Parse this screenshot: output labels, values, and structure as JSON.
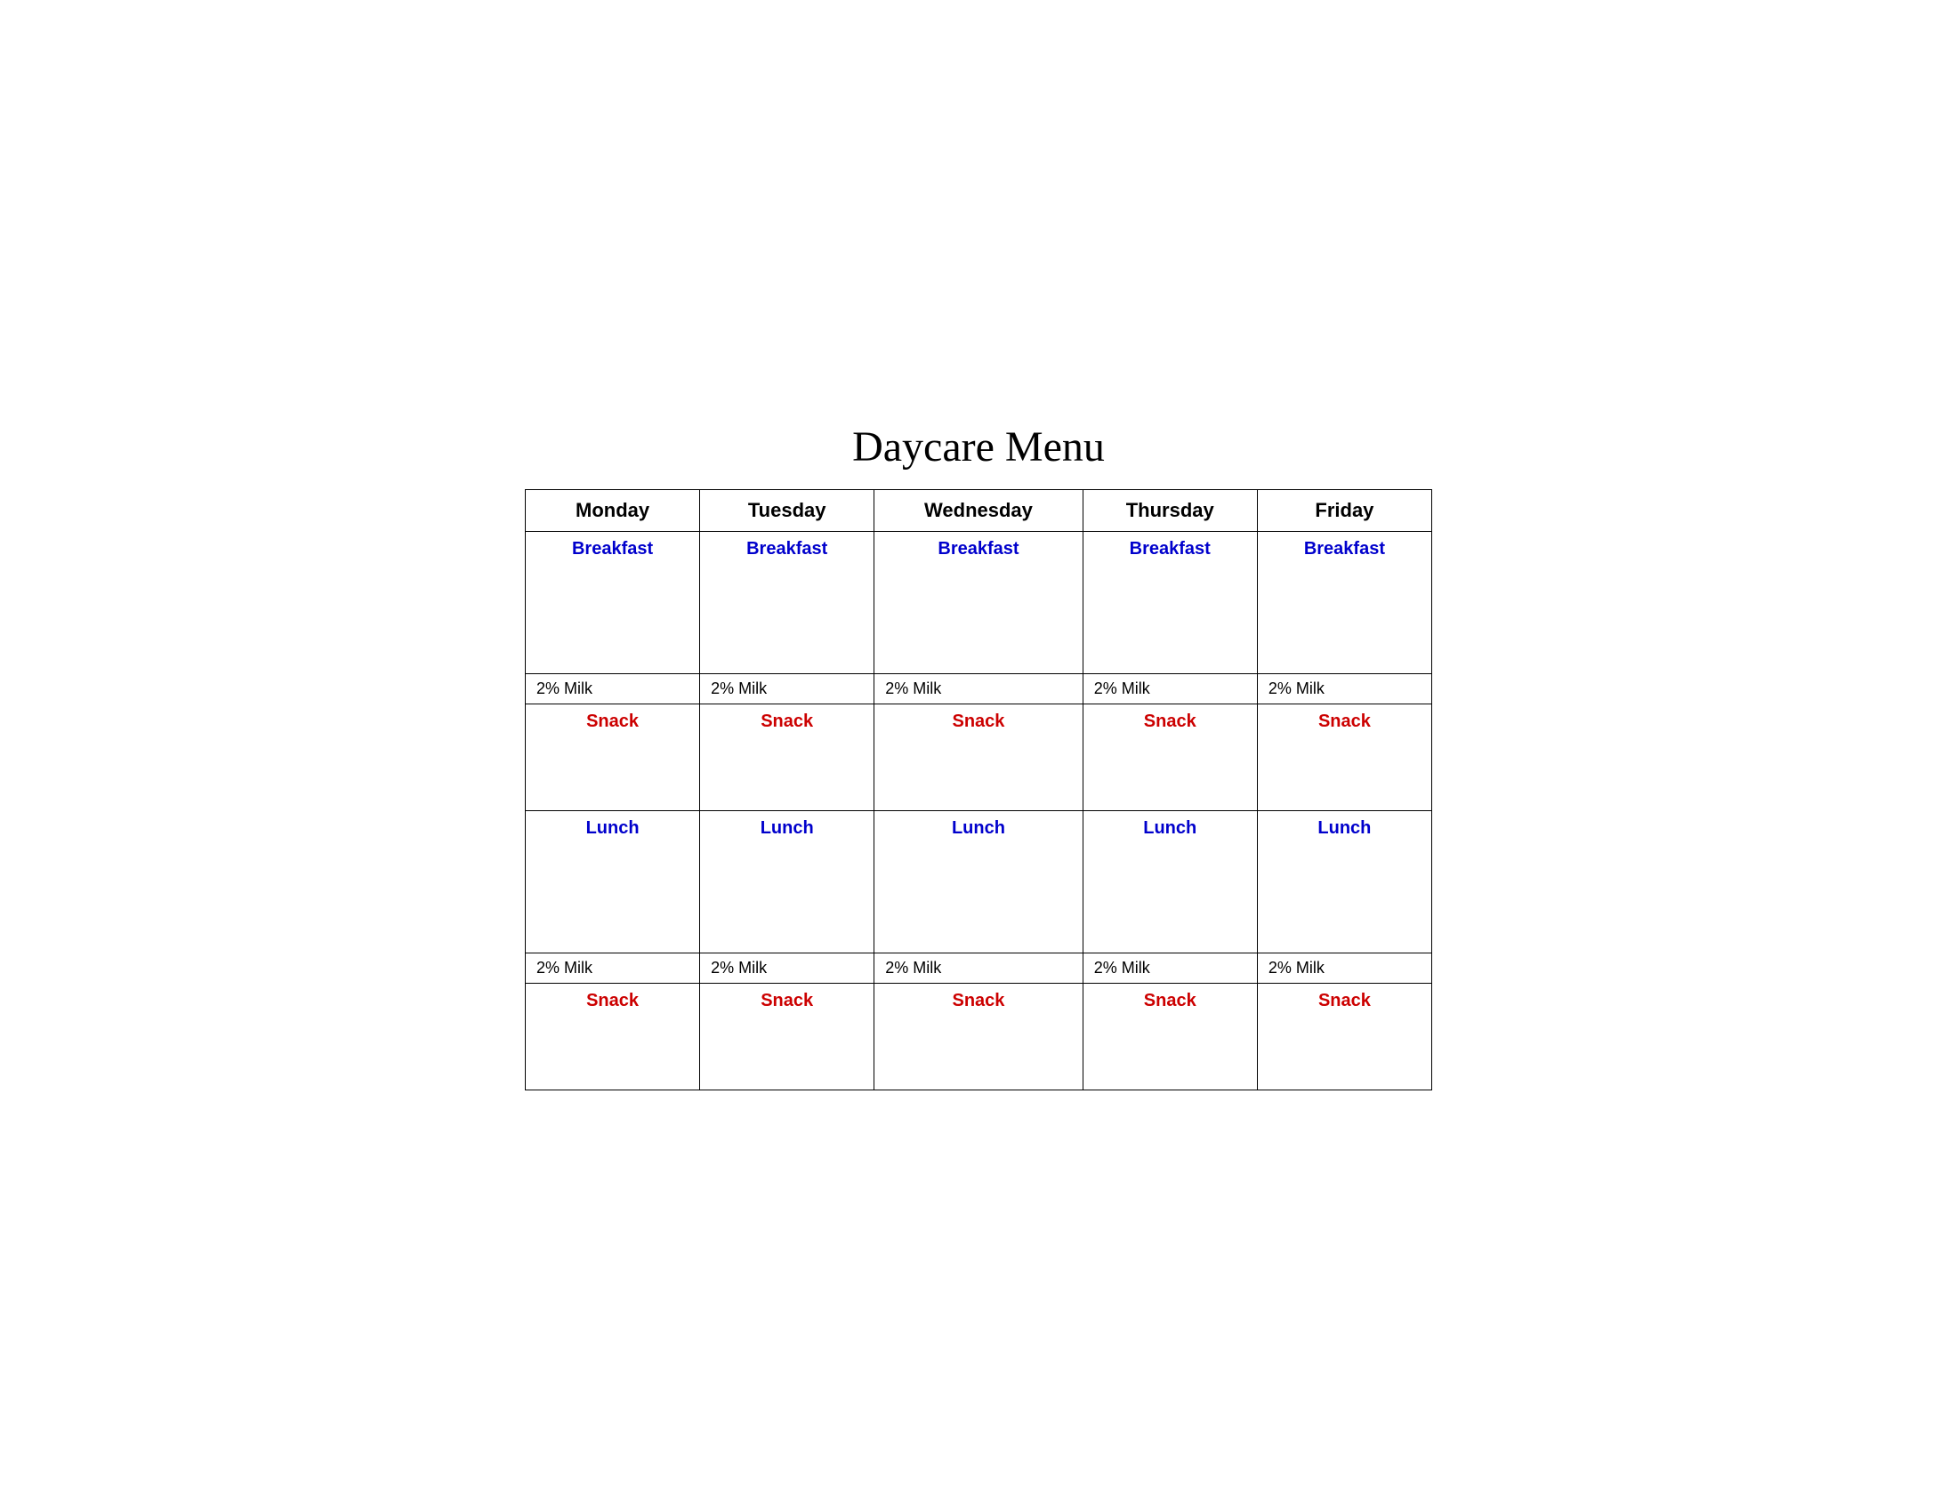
{
  "page": {
    "title": "Daycare Menu"
  },
  "table": {
    "headers": [
      {
        "label": "Monday",
        "key": "monday"
      },
      {
        "label": "Tuesday",
        "key": "tuesday"
      },
      {
        "label": "Wednesday",
        "key": "wednesday"
      },
      {
        "label": "Thursday",
        "key": "thursday"
      },
      {
        "label": "Friday",
        "key": "friday"
      }
    ],
    "rows": {
      "breakfast_label": "Breakfast",
      "milk1_label": "2% Milk",
      "snack1_label": "Snack",
      "lunch_label": "Lunch",
      "milk2_label": "2% Milk",
      "snack2_label": "Snack"
    }
  }
}
